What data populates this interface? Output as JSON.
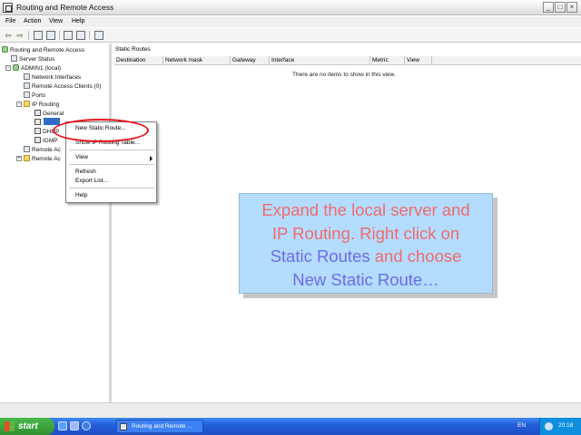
{
  "window": {
    "title": "Routing and Remote Access"
  },
  "menubar": {
    "file": "File",
    "action": "Action",
    "view": "View",
    "help": "Help"
  },
  "tree": {
    "root": "Routing and Remote Access",
    "server_status": "Server Status",
    "server": "ADMIN1 (local)",
    "network_interfaces": "Network Interfaces",
    "remote_access_clients": "Remote Access Clients (0)",
    "ports": "Ports",
    "ip_routing": "IP Routing",
    "general": "General",
    "dhcp_fragment": "DHCP",
    "igmp": "IGMP",
    "remote_access_policies_fragment": "Remote Ac",
    "remote_access_logging_fragment": "Remote Ac"
  },
  "content": {
    "title": "Static Routes",
    "columns": [
      "Destination",
      "Network mask",
      "Gateway",
      "Interface",
      "Metric",
      "View"
    ],
    "empty_message": "There are no items to show in this view."
  },
  "context_menu": {
    "items": [
      "New Static Route...",
      "Show IP Routing Table...",
      "View",
      "Refresh",
      "Export List...",
      "Help"
    ]
  },
  "callout": {
    "line1": "Expand the local server and",
    "line2": "IP Routing. Right click on",
    "line3_blue": "Static Routes",
    "line3_red": " and choose",
    "line4": "New Static Route…",
    "red_color": "#f06b6b",
    "blue_color": "#6b6be6"
  },
  "taskbar": {
    "start_label": "start",
    "task_button_label": "Routing and Remote ...",
    "language": "EN",
    "clock": "20:18"
  }
}
